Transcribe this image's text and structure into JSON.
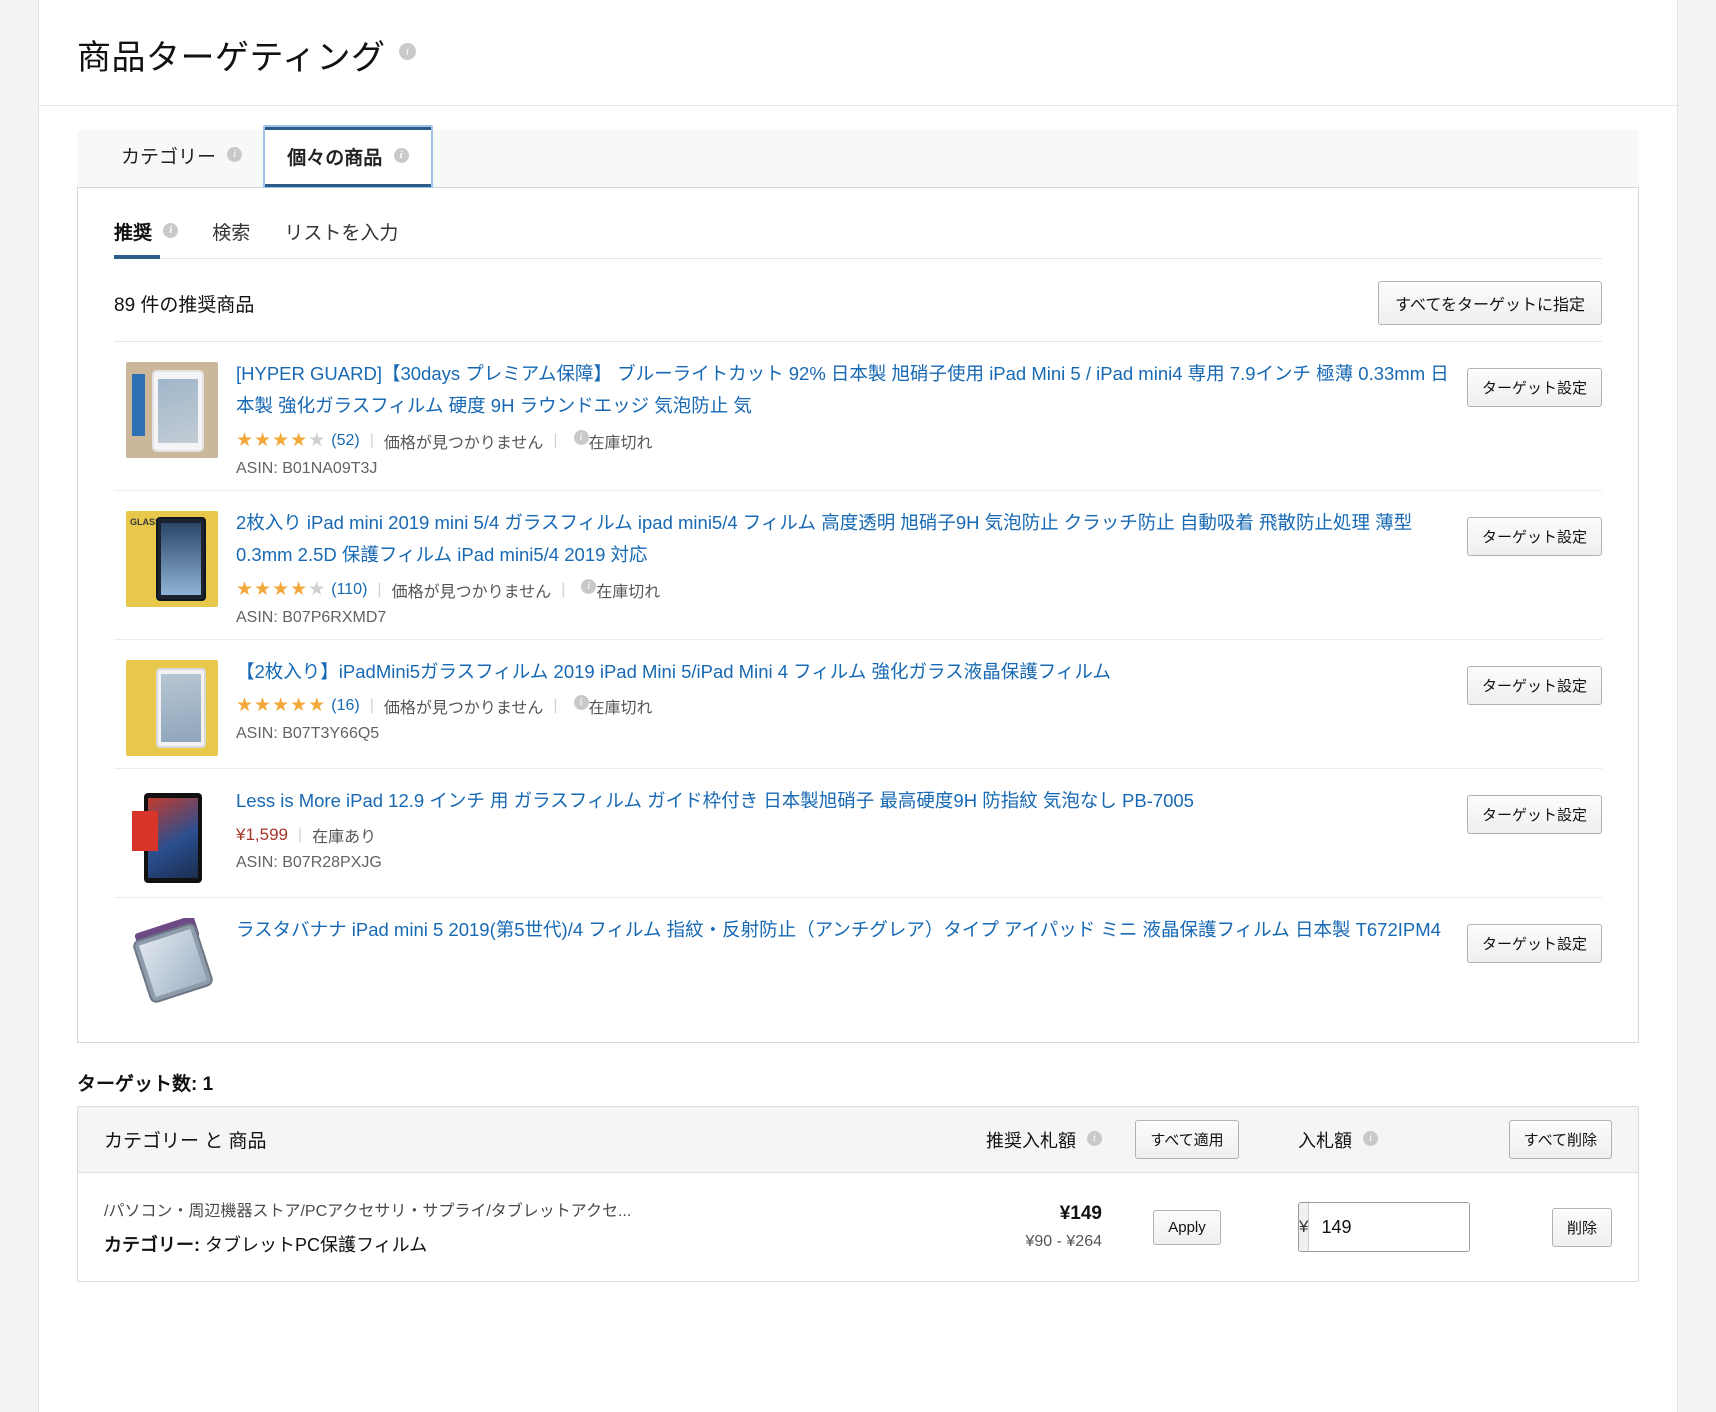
{
  "header": {
    "title": "商品ターゲティング",
    "info_icon": "info-icon"
  },
  "tabs": [
    {
      "label": "カテゴリー",
      "active": false
    },
    {
      "label": "個々の商品",
      "active": true
    }
  ],
  "subtabs": [
    {
      "label": "推奨",
      "active": true,
      "has_info": true
    },
    {
      "label": "検索",
      "active": false,
      "has_info": false
    },
    {
      "label": "リストを入力",
      "active": false,
      "has_info": false
    }
  ],
  "recommendations": {
    "count_label": "89 件の推奨商品",
    "target_all_button": "すべてをターゲットに指定",
    "row_button": "ターゲット設定",
    "products": [
      {
        "title": "[HYPER GUARD]【30days プレミアム保障】 ブルーライトカット 92% 日本製 旭硝子使用 iPad Mini 5 / iPad mini4 専用 7.9インチ 極薄 0.33mm 日本製 強化ガラスフィルム 硬度 9H ラウンドエッジ 気泡防止 気",
        "rating_filled": 4,
        "rating_total": 5,
        "review_count": "(52)",
        "price": "価格が見つかりません",
        "price_is_value": false,
        "stock": "在庫切れ",
        "stock_has_info": true,
        "asin": "ASIN: B01NA09T3J",
        "thumb": "tb-a"
      },
      {
        "title": "2枚入り iPad mini 2019 mini 5/4 ガラスフィルム ipad mini5/4 フィルム 高度透明 旭硝子9H 気泡防止 クラッチ防止 自動吸着 飛散防止処理 薄型 0.3mm 2.5D 保護フィルム iPad mini5/4 2019 対応",
        "rating_filled": 4,
        "rating_total": 5,
        "review_count": "(110)",
        "price": "価格が見つかりません",
        "price_is_value": false,
        "stock": "在庫切れ",
        "stock_has_info": true,
        "asin": "ASIN: B07P6RXMD7",
        "thumb": "tb-b"
      },
      {
        "title": "【2枚入り】iPadMini5ガラスフィルム 2019 iPad Mini 5/iPad Mini 4 フィルム 強化ガラス液晶保護フィルム",
        "rating_filled": 5,
        "rating_total": 5,
        "review_count": "(16)",
        "price": "価格が見つかりません",
        "price_is_value": false,
        "stock": "在庫切れ",
        "stock_has_info": true,
        "asin": "ASIN: B07T3Y66Q5",
        "thumb": "tb-c"
      },
      {
        "title": "Less is More iPad 12.9 インチ 用 ガラスフィルム ガイド枠付き 日本製旭硝子 最高硬度9H 防指紋 気泡なし PB-7005",
        "rating_filled": 0,
        "rating_total": 0,
        "review_count": "",
        "price": "¥1,599",
        "price_is_value": true,
        "stock": "在庫あり",
        "stock_has_info": false,
        "asin": "ASIN: B07R28PXJG",
        "thumb": "tb-d"
      },
      {
        "title": "ラスタバナナ iPad mini 5 2019(第5世代)/4 フィルム 指紋・反射防止（アンチグレア）タイプ アイパッド ミニ 液晶保護フィルム 日本製 T672IPM4",
        "rating_filled": 0,
        "rating_total": 0,
        "review_count": "",
        "price": "",
        "price_is_value": false,
        "stock": "",
        "stock_has_info": false,
        "asin": "",
        "thumb": "tb-e"
      }
    ]
  },
  "targets": {
    "count_label": "ターゲット数: 1",
    "columns": {
      "category_and_product": "カテゴリー と 商品",
      "suggested_bid": "推奨入札額",
      "apply_all": "すべて適用",
      "bid": "入札額",
      "delete_all": "すべて削除"
    },
    "rows": [
      {
        "path": "/パソコン・周辺機器ストア/PCアクセサリ・サプライ/タブレットアクセ...",
        "name_prefix": "カテゴリー:",
        "name": " タブレットPC保護フィルム",
        "suggested_bid": "¥149",
        "bid_range": "¥90 - ¥264",
        "apply_button": "Apply",
        "currency_symbol": "¥",
        "bid_value": "149",
        "delete_button": "削除"
      }
    ]
  },
  "colors": {
    "link": "#1769b4",
    "tab_accent": "#2b5d88",
    "star": "#f2a83b",
    "price": "#a7352a"
  },
  "icons": {
    "info": "i",
    "star_filled": "★",
    "star_empty": "★"
  }
}
